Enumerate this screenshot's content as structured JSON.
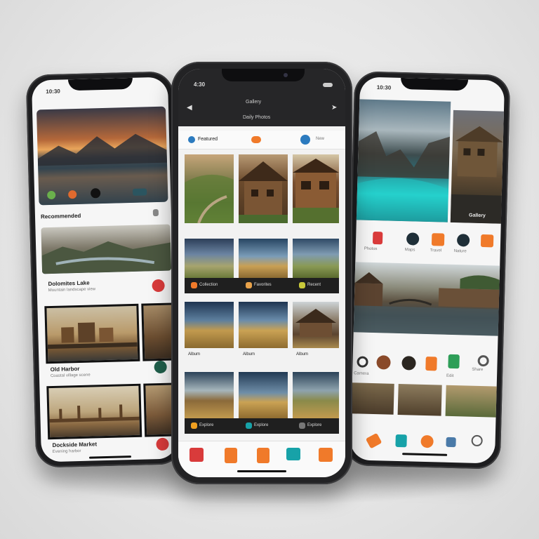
{
  "left_phone": {
    "status": "10:30",
    "section1_title": "Recommended",
    "item1_title": "Dolomites Lake",
    "item1_sub": "Mountain landscape view",
    "item2_title": "Old Harbor",
    "item2_sub": "Coastal village scene",
    "item3_title": "Dockside Market",
    "item3_sub": "Evening harbor"
  },
  "center_phone": {
    "status": "4:30",
    "header_title": "Gallery",
    "header_sub": "Daily Photos",
    "chip1": "Featured",
    "chip2": "New",
    "row2_labels": [
      "Collection",
      "Favorites",
      "Recent"
    ],
    "row3_labels": [
      "Album",
      "Album",
      "Album"
    ],
    "row4_labels": [
      "Explore",
      "Explore",
      "Explore"
    ],
    "tabs": [
      "home",
      "albums",
      "camera",
      "shared",
      "profile"
    ]
  },
  "right_phone": {
    "status": "10:30",
    "icon_labels": [
      "Photos",
      "Maps",
      "Travel",
      "Nature"
    ],
    "bottom_labels": [
      "Camera",
      "Edit",
      "Share"
    ],
    "side_label": "Gallery"
  },
  "colors": {
    "red": "#d93b3b",
    "orange": "#f07a2a",
    "teal": "#17a2a8",
    "green": "#2e9e58",
    "dark": "#1d1d1f"
  }
}
